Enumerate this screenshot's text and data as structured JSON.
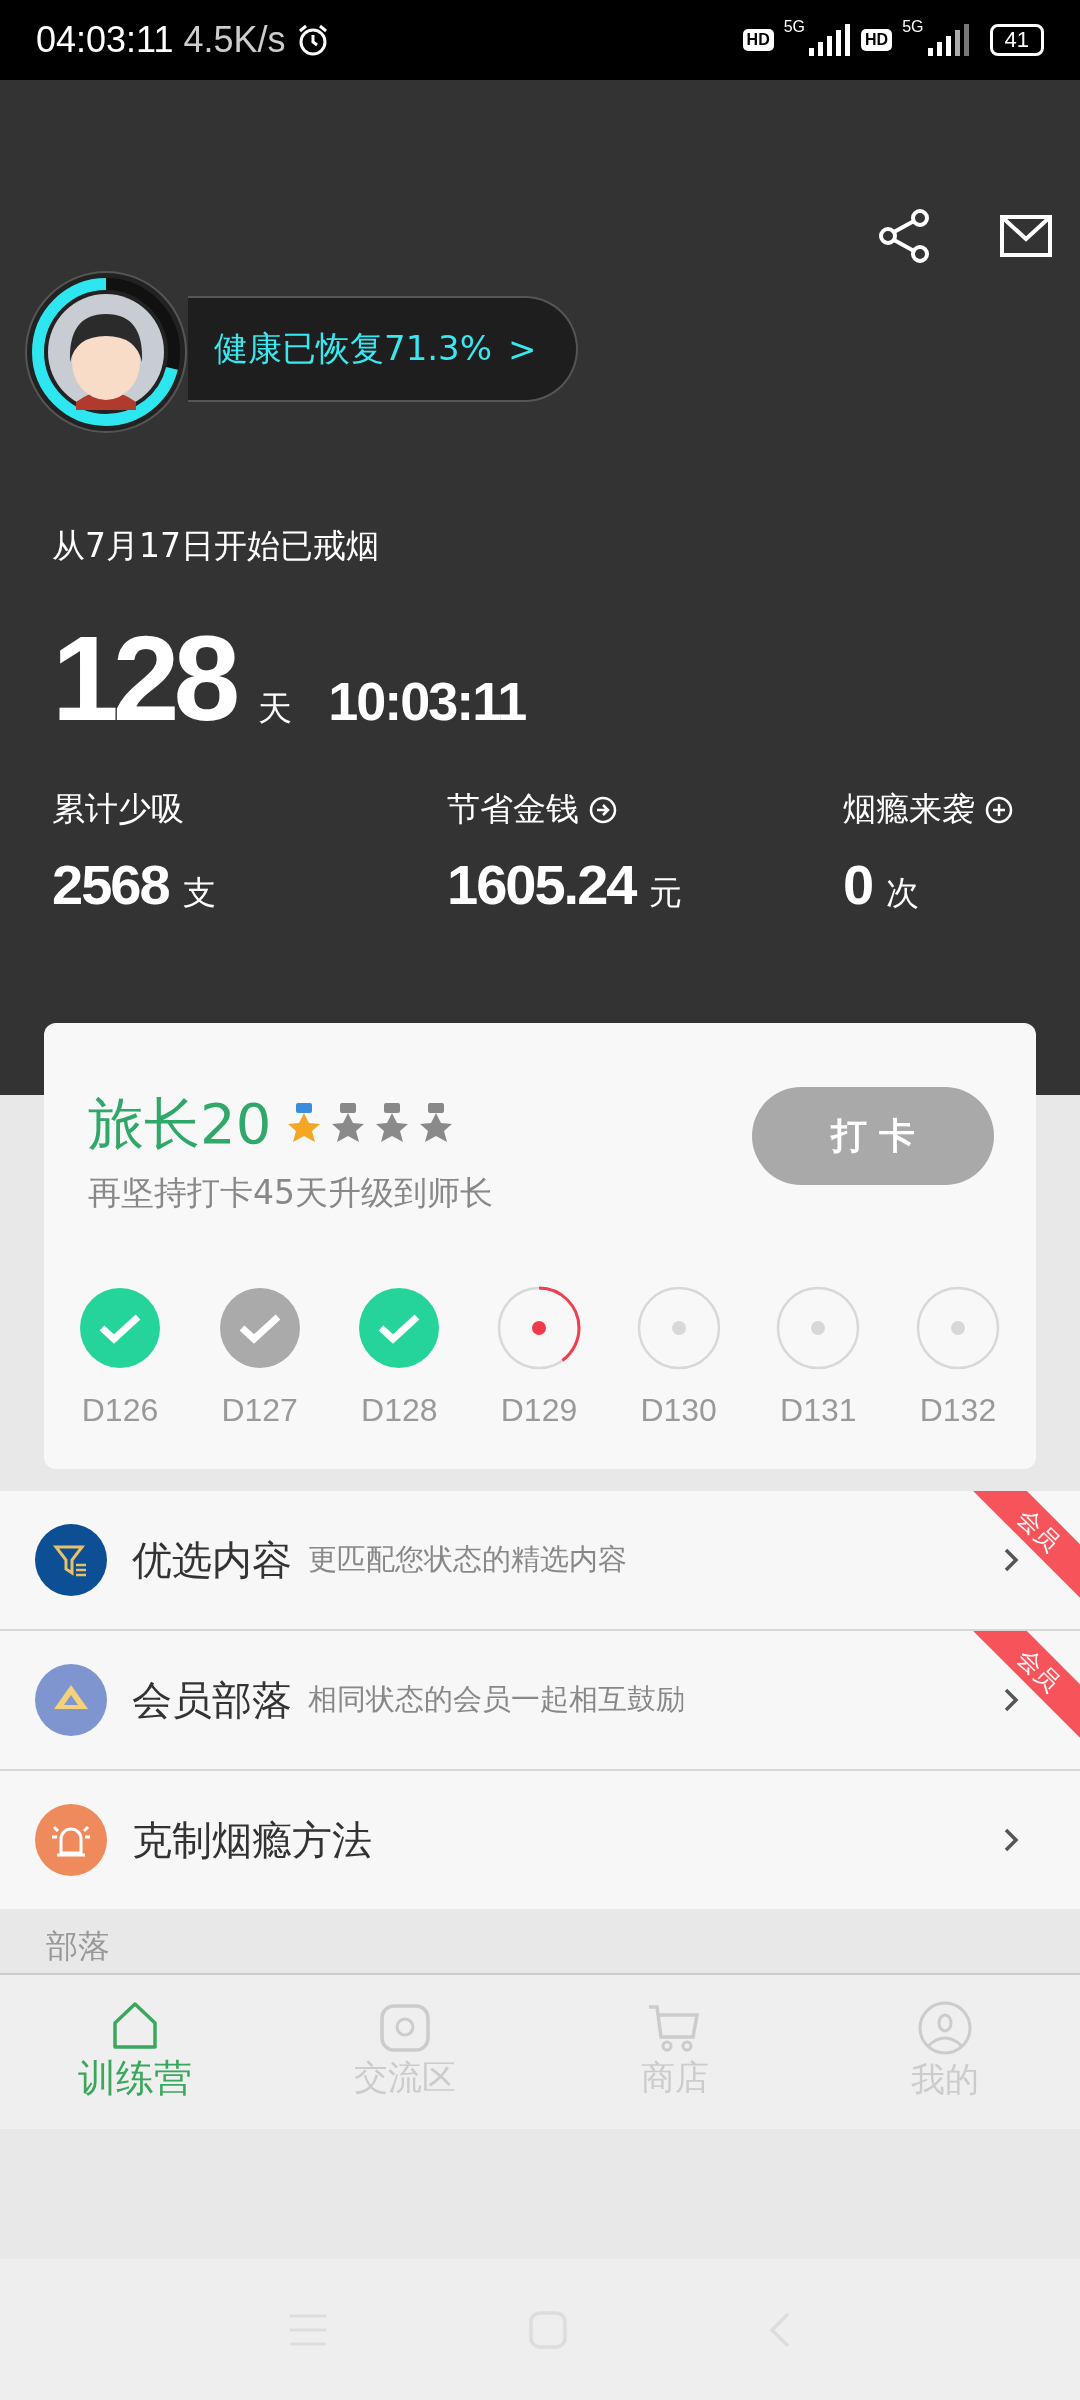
{
  "status_bar": {
    "time": "04:03:11",
    "speed": "4.5K/s",
    "signals": [
      {
        "hd": "HD",
        "gen": "5G"
      },
      {
        "hd": "HD",
        "gen": "5G"
      }
    ],
    "battery": "41"
  },
  "health": {
    "label": "健康已恢复71.3%",
    "chevron": ">",
    "level": 0.71
  },
  "quit_since": "从7月17日开始已戒烟",
  "counter": {
    "days": "128",
    "days_unit": "天",
    "time": "10:03:11"
  },
  "stats": [
    {
      "label": "累计少吸",
      "value": "2568",
      "unit": "支"
    },
    {
      "label": "节省金钱",
      "value": "1605.24",
      "unit": "元"
    },
    {
      "label": "烟瘾来袭",
      "value": "0",
      "unit": "次"
    }
  ],
  "rank": {
    "title": "旅长20",
    "stars": 1,
    "hint": "再坚持打卡45天升级到师长",
    "button": "打 卡"
  },
  "days": [
    {
      "label": "D126",
      "kind": "done"
    },
    {
      "label": "D127",
      "kind": "missed"
    },
    {
      "label": "D128",
      "kind": "done"
    },
    {
      "label": "D129",
      "kind": "today",
      "level": 0.4
    },
    {
      "label": "D130",
      "kind": "future"
    },
    {
      "label": "D131",
      "kind": "future"
    },
    {
      "label": "D132",
      "kind": "future"
    }
  ],
  "menu": [
    {
      "title": "优选内容",
      "subtitle": "更匹配您状态的精选内容",
      "color": "#0d4f94",
      "badge": "会员"
    },
    {
      "title": "会员部落",
      "subtitle": "相同状态的会员一起相互鼓励",
      "color": "#7f95cf",
      "badge": "会员"
    },
    {
      "title": "克制烟瘾方法",
      "color": "#ee8a5c"
    }
  ],
  "section_title": "部落",
  "nav": [
    {
      "label": "训练营",
      "selected": true
    },
    {
      "label": "交流区",
      "selected": false
    },
    {
      "label": "商店",
      "selected": false
    },
    {
      "label": "我的",
      "selected": false
    }
  ]
}
